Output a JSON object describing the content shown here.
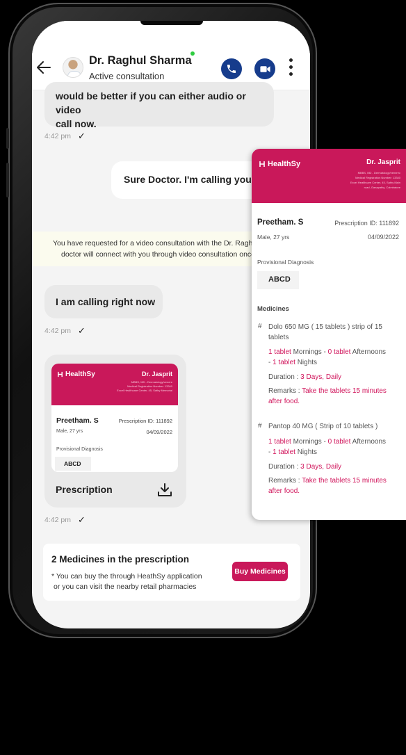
{
  "header": {
    "doctor_name": "Dr. Raghul Sharma",
    "status": "Active consultation"
  },
  "chat": {
    "msg1_line1": "would be better if you can either audio or video",
    "msg1_line2": "call now.",
    "time1": "4:42 pm",
    "msg2": "Sure Doctor. I'm calling you right",
    "notice_line1": "You have requested for a video consultation with the Dr. Raghul Sha",
    "notice_line2": "doctor will connect with you through video consultation once ava",
    "msg3": "I am calling right now",
    "time2": "4:42 pm",
    "time3": "4:42 pm",
    "tick": "✓"
  },
  "prescription_card": {
    "brand": "HealthSy",
    "doctor": "Dr. Jasprit",
    "band_line1": "MBBS, MD - Dermatology/venere",
    "band_line2": "Medical Registration Number: 13340",
    "band_line3": "Excel Healthcare Center, 45, Sathy Memorial",
    "patient": "Preetham. S",
    "prescription_id": "Prescription ID: 111892",
    "patient_meta": "Male, 27 yrs",
    "date": "04/09/2022",
    "diag_label": "Provisional Diagnosis",
    "diag_value": "ABCD",
    "label": "Prescription"
  },
  "medicines_box": {
    "title": "2 Medicines in the prescription",
    "note_line1": "* You can buy the through HeathSy application",
    "note_line2": "or you can visit the nearby retail pharmacies",
    "button": "Buy Medicines"
  },
  "big_prescription": {
    "brand": "HealthSy",
    "doctor": "Dr. Jasprit",
    "band_line1": "MBBS, MD - Dermatology/venerec",
    "band_line2": "Medical Registration Number: 13340",
    "band_line3": "Excel Healthcare Center, 45, Sathy Main",
    "band_line4": "road, Ganapathy, Coimbatore",
    "patient": "Preetham. S",
    "prescription_id": "Prescription ID: 111892",
    "patient_meta": "Male, 27 yrs",
    "date": "04/09/2022",
    "diag_label": "Provisional Diagnosis",
    "diag_value": "ABCD",
    "medicines_label": "Medicines",
    "meds": [
      {
        "hash": "#",
        "name_line1": "Dolo 650 MG ( 15 tablets ) strip of 15",
        "name_line2": "tablets",
        "dose_a": "1 tablet",
        "dose_b": " Mornings - ",
        "dose_c": "0 tablet",
        "dose_d": " Afternoons",
        "dose_e": "- ",
        "dose_f": "1 tablet",
        "dose_g": " Nights",
        "duration_label": "Duration : ",
        "duration_value": "3 Days, Daily",
        "remarks_label": "Remarks : ",
        "remarks_value1": "Take the tablets  15 minutes",
        "remarks_value2": "after food."
      },
      {
        "hash": "#",
        "name_line1": "Pantop 40 MG ( Strip of 10 tablets )",
        "dose_a": "1 tablet",
        "dose_b": " Mornings - ",
        "dose_c": "0 tablet",
        "dose_d": " Afternoons",
        "dose_e": "- ",
        "dose_f": "1 tablet",
        "dose_g": " Nights",
        "duration_label": "Duration : ",
        "duration_value": "3 Days, Daily",
        "remarks_label": "Remarks : ",
        "remarks_value1": "Take the tablets  15 minutes",
        "remarks_value2": "after food."
      }
    ]
  },
  "colors": {
    "brand": "#c9185a",
    "call_button": "#163c8c",
    "online": "#2ecc40"
  }
}
